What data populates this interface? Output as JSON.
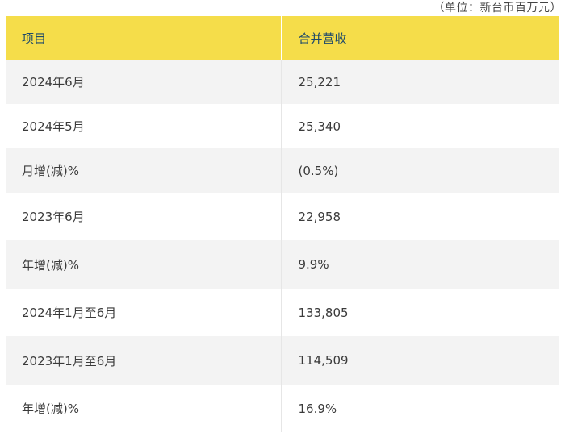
{
  "unit_note": "（单位：新台币百万元）",
  "table": {
    "headers": [
      "项目",
      "合并营收"
    ],
    "rows": [
      {
        "item": "2024年6月",
        "value": "25,221"
      },
      {
        "item": "2024年5月",
        "value": "25,340"
      },
      {
        "item": "月增(减)%",
        "value": "(0.5%)"
      },
      {
        "item": "2023年6月",
        "value": "22,958"
      },
      {
        "item": "年增(减)%",
        "value": "9.9%"
      },
      {
        "item": "2024年1月至6月",
        "value": "133,805"
      },
      {
        "item": "2023年1月至6月",
        "value": "114,509"
      },
      {
        "item": "年增(减)%",
        "value": "16.9%"
      }
    ]
  },
  "colors": {
    "header_bg": "#f5dd4a",
    "header_text": "#1e4a6a",
    "row_alt_bg": "#f3f3f3"
  }
}
